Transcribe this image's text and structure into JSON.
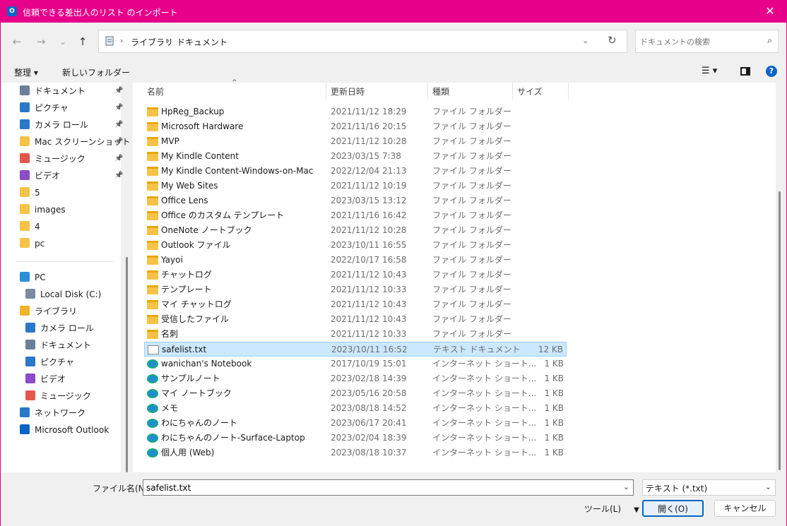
{
  "window": {
    "title": "信頼できる差出人のリスト のインポート",
    "app_icon": "outlook-icon",
    "close_glyph": "✕",
    "border_color": "#e6008a"
  },
  "nav": {
    "back": "←",
    "forward": "→",
    "recent": "⌄",
    "up": "↑"
  },
  "address": {
    "crumbs": [
      "ライブラリ",
      "ドキュメント"
    ],
    "separator": "›"
  },
  "search": {
    "placeholder": "ドキュメントの検索"
  },
  "toolbar": {
    "organize": "整理 ▾",
    "new_folder": "新しいフォルダー",
    "view": "☰ ▾",
    "help": "?"
  },
  "sidebar": {
    "quick": [
      {
        "label": "ドキュメント",
        "icon": "document-icon",
        "pinned": true
      },
      {
        "label": "ピクチャ",
        "icon": "picture-icon",
        "pinned": true
      },
      {
        "label": "カメラ ロール",
        "icon": "camera-roll-icon",
        "pinned": true
      },
      {
        "label": "Mac スクリーンショット",
        "icon": "folder-icon",
        "pinned": true
      },
      {
        "label": "ミュージック",
        "icon": "music-icon",
        "pinned": true
      },
      {
        "label": "ビデオ",
        "icon": "video-icon",
        "pinned": true
      },
      {
        "label": "5",
        "icon": "folder-icon",
        "pinned": false
      },
      {
        "label": "images",
        "icon": "folder-icon",
        "pinned": false
      },
      {
        "label": "4",
        "icon": "folder-icon",
        "pinned": false
      },
      {
        "label": "pc",
        "icon": "folder-icon",
        "pinned": false
      }
    ],
    "tree": [
      {
        "label": "PC",
        "icon": "pc-icon"
      },
      {
        "label": "Local Disk (C:)",
        "icon": "disk-icon"
      },
      {
        "label": "ライブラリ",
        "icon": "library-icon"
      },
      {
        "label": "カメラ ロール",
        "icon": "camera-roll-icon"
      },
      {
        "label": "ドキュメント",
        "icon": "document-icon"
      },
      {
        "label": "ピクチャ",
        "icon": "picture-icon"
      },
      {
        "label": "ビデオ",
        "icon": "video-icon"
      },
      {
        "label": "ミュージック",
        "icon": "music-icon"
      },
      {
        "label": "ネットワーク",
        "icon": "network-icon"
      },
      {
        "label": "Microsoft Outlook",
        "icon": "outlook-icon"
      }
    ]
  },
  "columns": {
    "name": "名前",
    "date": "更新日時",
    "type": "種類",
    "size": "サイズ",
    "sort_glyph": "^"
  },
  "files": [
    {
      "name": "HpReg_Backup",
      "date": "2021/11/12 18:29",
      "type": "ファイル フォルダー",
      "size": "",
      "icon": "folder-icon"
    },
    {
      "name": "Microsoft Hardware",
      "date": "2021/11/16 20:15",
      "type": "ファイル フォルダー",
      "size": "",
      "icon": "folder-icon"
    },
    {
      "name": "MVP",
      "date": "2021/11/12 10:28",
      "type": "ファイル フォルダー",
      "size": "",
      "icon": "folder-icon"
    },
    {
      "name": "My Kindle Content",
      "date": "2023/03/15 7:38",
      "type": "ファイル フォルダー",
      "size": "",
      "icon": "folder-icon"
    },
    {
      "name": "My Kindle Content-Windows-on-Mac",
      "date": "2022/12/04 21:13",
      "type": "ファイル フォルダー",
      "size": "",
      "icon": "folder-icon"
    },
    {
      "name": "My Web Sites",
      "date": "2021/11/12 10:19",
      "type": "ファイル フォルダー",
      "size": "",
      "icon": "folder-icon"
    },
    {
      "name": "Office Lens",
      "date": "2023/03/15 13:12",
      "type": "ファイル フォルダー",
      "size": "",
      "icon": "folder-icon"
    },
    {
      "name": "Office のカスタム テンプレート",
      "date": "2021/11/16 16:42",
      "type": "ファイル フォルダー",
      "size": "",
      "icon": "folder-icon"
    },
    {
      "name": "OneNote ノートブック",
      "date": "2021/11/12 10:28",
      "type": "ファイル フォルダー",
      "size": "",
      "icon": "folder-icon"
    },
    {
      "name": "Outlook ファイル",
      "date": "2023/10/11 16:55",
      "type": "ファイル フォルダー",
      "size": "",
      "icon": "folder-icon"
    },
    {
      "name": "Yayoi",
      "date": "2022/10/17 16:58",
      "type": "ファイル フォルダー",
      "size": "",
      "icon": "folder-icon"
    },
    {
      "name": "チャットログ",
      "date": "2021/11/12 10:43",
      "type": "ファイル フォルダー",
      "size": "",
      "icon": "folder-icon"
    },
    {
      "name": "テンプレート",
      "date": "2021/11/12 10:33",
      "type": "ファイル フォルダー",
      "size": "",
      "icon": "folder-icon"
    },
    {
      "name": "マイ チャットログ",
      "date": "2021/11/12 10:43",
      "type": "ファイル フォルダー",
      "size": "",
      "icon": "folder-icon"
    },
    {
      "name": "受信したファイル",
      "date": "2021/11/12 10:43",
      "type": "ファイル フォルダー",
      "size": "",
      "icon": "folder-icon"
    },
    {
      "name": "名刺",
      "date": "2021/11/12 10:33",
      "type": "ファイル フォルダー",
      "size": "",
      "icon": "folder-icon"
    },
    {
      "name": "safelist.txt",
      "date": "2023/10/11 16:52",
      "type": "テキスト ドキュメント",
      "size": "12 KB",
      "icon": "text-file-icon",
      "selected": true
    },
    {
      "name": "wanichan's Notebook",
      "date": "2017/10/19 15:01",
      "type": "インターネット ショート...",
      "size": "1 KB",
      "icon": "internet-shortcut-icon"
    },
    {
      "name": "サンプルノート",
      "date": "2023/02/18 14:39",
      "type": "インターネット ショート...",
      "size": "1 KB",
      "icon": "internet-shortcut-icon"
    },
    {
      "name": "マイ ノートブック",
      "date": "2023/05/16 20:58",
      "type": "インターネット ショート...",
      "size": "1 KB",
      "icon": "internet-shortcut-icon"
    },
    {
      "name": "メモ",
      "date": "2023/08/18 14:52",
      "type": "インターネット ショート...",
      "size": "1 KB",
      "icon": "internet-shortcut-icon"
    },
    {
      "name": "わにちゃんのノート",
      "date": "2023/06/17 20:41",
      "type": "インターネット ショート...",
      "size": "1 KB",
      "icon": "internet-shortcut-icon"
    },
    {
      "name": "わにちゃんのノート-Surface-Laptop",
      "date": "2023/02/04 18:39",
      "type": "インターネット ショート...",
      "size": "1 KB",
      "icon": "internet-shortcut-icon"
    },
    {
      "name": "個人用 (Web)",
      "date": "2023/08/18 10:37",
      "type": "インターネット ショート...",
      "size": "1 KB",
      "icon": "internet-shortcut-icon"
    }
  ],
  "footer": {
    "filename_label": "ファイル名(N):",
    "filename_value": "safelist.txt",
    "filetype_value": "テキスト (*.txt)",
    "tools_label": "ツール(L)",
    "tools_arrow": "▼",
    "open_label": "開く(O)",
    "cancel_label": "キャンセル",
    "dropdown_glyph": "⌄"
  },
  "colors": {
    "accent": "#0067c0",
    "selection": "#cce8ff",
    "folder": "#f7c247"
  }
}
